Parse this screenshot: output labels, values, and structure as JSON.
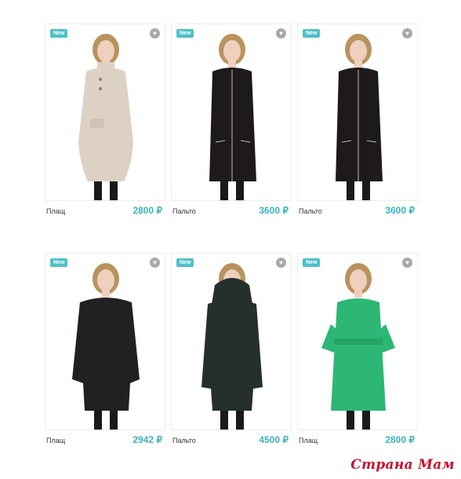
{
  "products": [
    {
      "badge": "New",
      "name": "Плащ",
      "price": "2800 ₽",
      "coat": "#ddd1c6",
      "style": "trench"
    },
    {
      "badge": "New",
      "name": "Пальто",
      "price": "3600 ₽",
      "coat": "#1e1a1c",
      "style": "zip"
    },
    {
      "badge": "New",
      "name": "Пальто",
      "price": "3600 ₽",
      "coat": "#1e1a1c",
      "style": "zip-raised"
    },
    {
      "badge": "New",
      "name": "Плащ",
      "price": "2942 ₽",
      "coat": "#232023",
      "style": "round"
    },
    {
      "badge": "New",
      "name": "Пальто",
      "price": "4500 ₽",
      "coat": "#26302b",
      "style": "hood"
    },
    {
      "badge": "New",
      "name": "Плащ",
      "price": "2800 ₽",
      "coat": "#2db774",
      "style": "belt"
    }
  ],
  "favorite_icon": "heart-icon",
  "watermark": "Страна Мам"
}
